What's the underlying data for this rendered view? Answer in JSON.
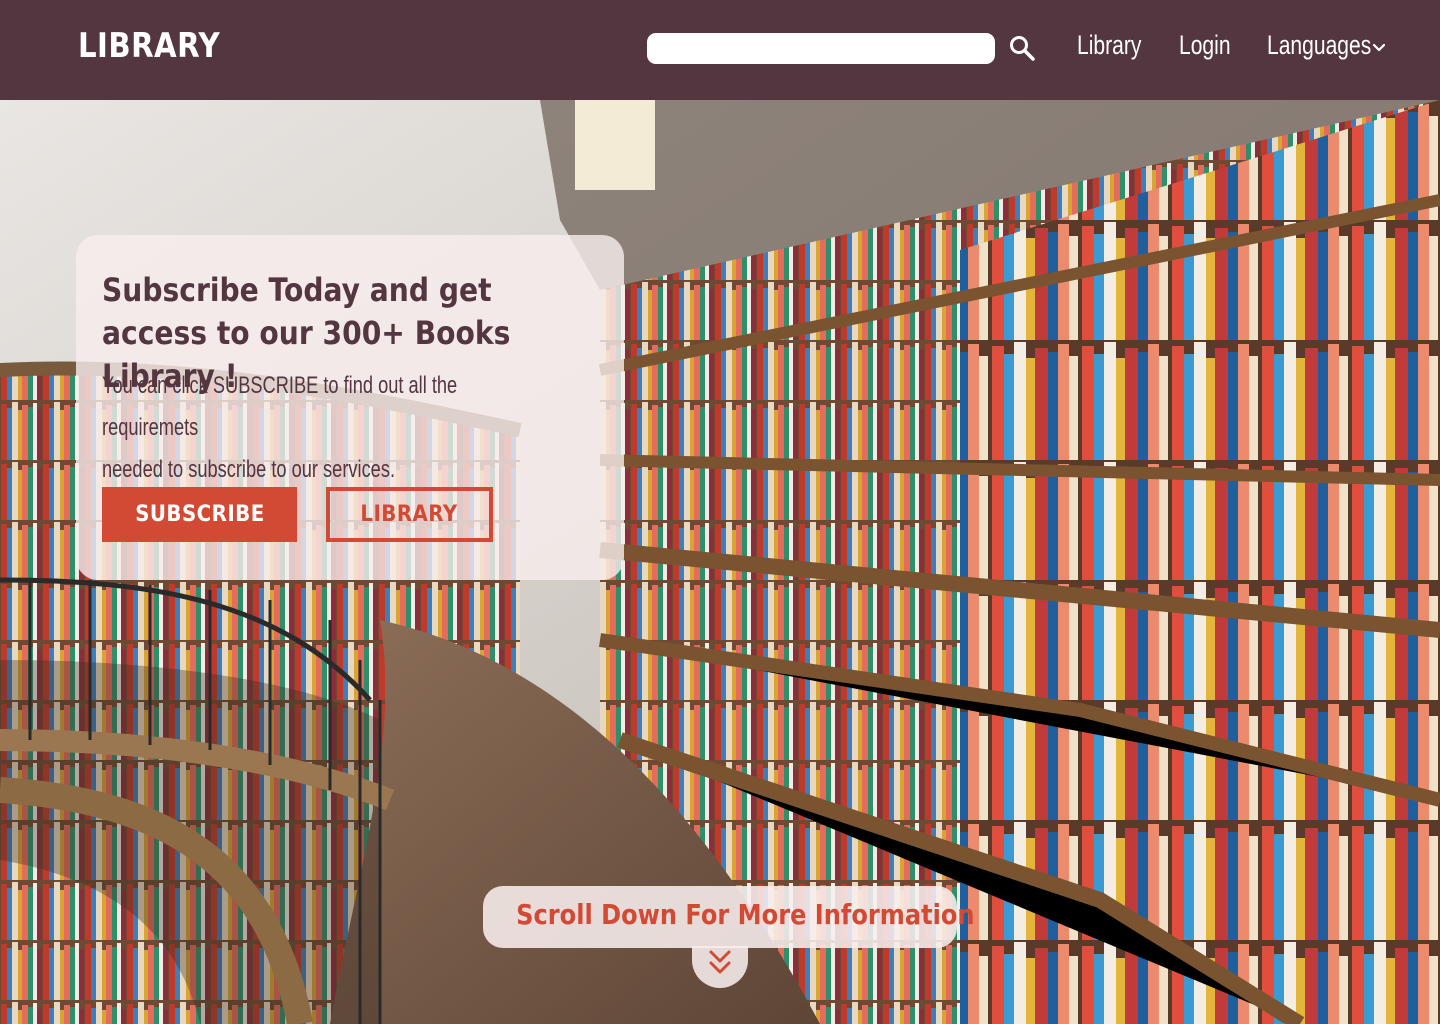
{
  "header": {
    "logo": "LIBRARY",
    "search": {
      "value": "",
      "placeholder": ""
    },
    "nav": [
      {
        "label": "Library"
      },
      {
        "label": "Login"
      },
      {
        "label": "Languages"
      }
    ],
    "icons": {
      "search": "search-icon",
      "dropdown": "chevron-down-icon"
    }
  },
  "hero": {
    "background": "library-bookshelves-photo",
    "card": {
      "title": "Subscribe Today and get access to our 300+ Books Library !",
      "body_line1": "You can click  SUBSCRIBE  to find out all the requiremets",
      "body_line2": "needed to subscribe to our services.",
      "subscribe_label": "SUBSCRIBE",
      "library_label": "LIBRARY"
    },
    "scroll_hint": "Scroll Down For More Information",
    "scroll_icon": "double-chevron-down-icon"
  },
  "colors": {
    "header_bg": "#543640",
    "accent": "#d24a34",
    "card_bg": "#f8eeee",
    "text_dark": "#543640"
  }
}
